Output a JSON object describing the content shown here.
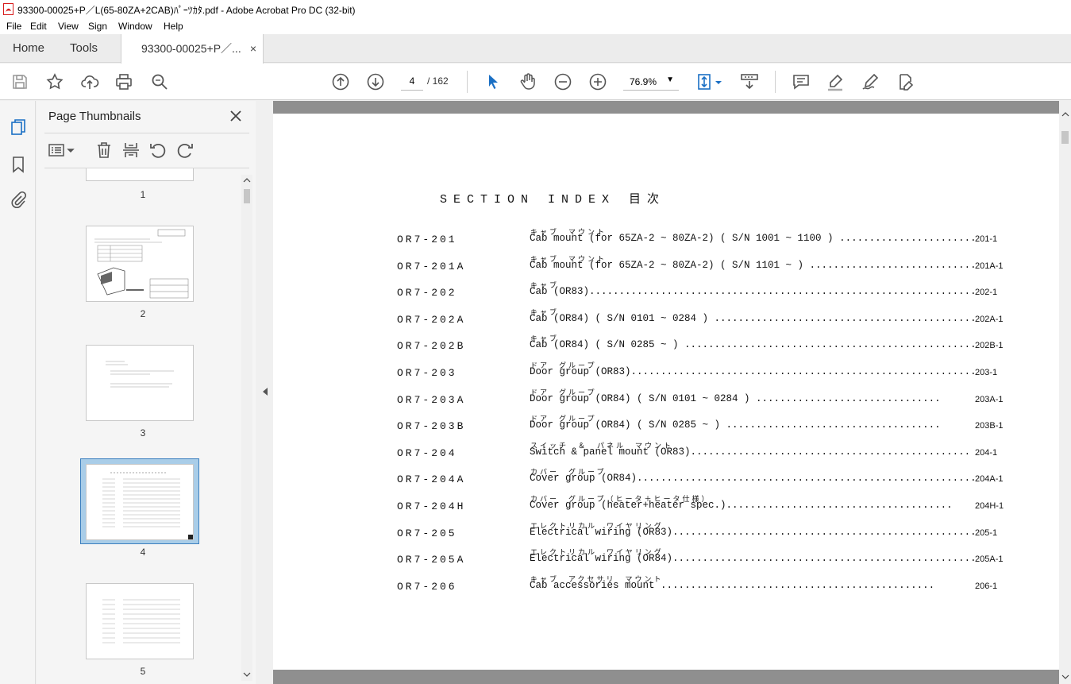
{
  "window": {
    "title": "93300-00025+P／L(65-80ZA+2CAB)ﾊﾟｰﾂｶﾀ.pdf - Adobe Acrobat Pro DC (32-bit)"
  },
  "menu": {
    "items": [
      "File",
      "Edit",
      "View",
      "Sign",
      "Window",
      "Help"
    ]
  },
  "tabs": {
    "home": "Home",
    "tools": "Tools",
    "document": "93300-00025+P／...",
    "close_symbol": "×"
  },
  "toolbar": {
    "page_current": "4",
    "page_total": "/ 162",
    "zoom": "76.9%"
  },
  "panel": {
    "title": "Page Thumbnails",
    "thumbnails": [
      {
        "label": "1"
      },
      {
        "label": "2"
      },
      {
        "label": "3"
      },
      {
        "label": "4",
        "selected": true
      },
      {
        "label": "5"
      }
    ]
  },
  "document": {
    "heading": "SECTION INDEX 目次",
    "rows": [
      {
        "code": "OR7-201",
        "kana": "キャブ　マウント",
        "title": "Cab mount (for 65ZA-2 ~ 80ZA-2) ( S/N 1001 ~ 1100 ) ..........................",
        "page": "201-1"
      },
      {
        "code": "OR7-201A",
        "kana": "キャブ　マウント",
        "title": "Cab mount (for 65ZA-2 ~ 80ZA-2) ( S/N 1101 ~ ) ..............................",
        "page": "201A-1"
      },
      {
        "code": "OR7-202",
        "kana": "キャブ",
        "title": "Cab (OR83)...................................................................",
        "page": "202-1"
      },
      {
        "code": "OR7-202A",
        "kana": "キャブ",
        "title": "Cab (OR84) ( S/N 0101 ~ 0284 ) ..............................................",
        "page": "202A-1"
      },
      {
        "code": "OR7-202B",
        "kana": "キャブ",
        "title": "Cab (OR84) ( S/N 0285 ~ ) ...................................................",
        "page": "202B-1"
      },
      {
        "code": "OR7-203",
        "kana": "ドア　グループ",
        "title": "Door group (OR83)............................................................",
        "page": "203-1"
      },
      {
        "code": "OR7-203A",
        "kana": "ドア　グループ",
        "title": "Door group (OR84) ( S/N 0101 ~ 0284 ) ...............................",
        "page": "203A-1"
      },
      {
        "code": "OR7-203B",
        "kana": "ドア　グループ",
        "title": "Door group (OR84) ( S/N 0285 ~ ) ....................................",
        "page": "203B-1"
      },
      {
        "code": "OR7-204",
        "kana": "スイッチ　＆　パネル　マウント",
        "title": "Switch & panel mount (OR83)...............................................",
        "page": "204-1"
      },
      {
        "code": "OR7-204A",
        "kana": "カバー　グループ",
        "title": "Cover group (OR84)..........................................................",
        "page": "204A-1"
      },
      {
        "code": "OR7-204H",
        "kana": "カバー　グループ（ヒータ＋ヒータ仕様）",
        "title": "Cover group (heater+heater spec.)......................................",
        "page": "204H-1"
      },
      {
        "code": "OR7-205",
        "kana": "エレクトリカル　ワイヤリング",
        "title": "Electrical wiring (OR83)....................................................",
        "page": "205-1"
      },
      {
        "code": "OR7-205A",
        "kana": "エレクトリカル　ワイヤリング",
        "title": "Electrical wiring (OR84)....................................................",
        "page": "205A-1"
      },
      {
        "code": "OR7-206",
        "kana": "キャブ　アクセサリ　マウント",
        "title": "Cab accessories mount ..............................................",
        "page": "206-1"
      }
    ]
  },
  "colors": {
    "accent": "#1a6fc4",
    "selection": "#a9cde8",
    "viewer_bg": "#8f8f8f",
    "icon": "#555555",
    "pdf_red": "#d71a1a"
  }
}
